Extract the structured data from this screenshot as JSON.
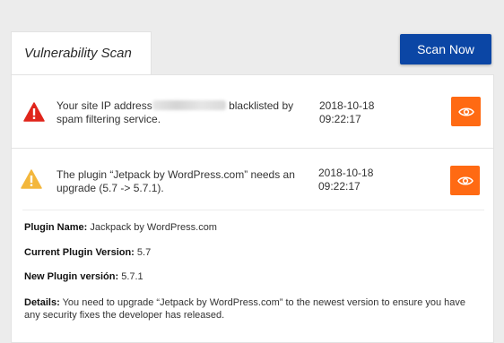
{
  "tab": {
    "title": "Vulnerability Scan"
  },
  "scan_button": {
    "label": "Scan Now"
  },
  "colors": {
    "accent_blue": "#0b46a5",
    "accent_orange": "#ff6a13",
    "error_red": "#e0251b",
    "warning_yellow": "#f3b73c"
  },
  "issues": [
    {
      "icon": "error-triangle-icon",
      "message_before": "Your site IP address",
      "message_after": "blacklisted by spam filtering service.",
      "date": "2018-10-18",
      "time": "09:22:17"
    },
    {
      "icon": "warning-triangle-icon",
      "message": "The plugin “Jetpack by WordPress.com” needs an upgrade (5.7 -> 5.7.1).",
      "date": "2018-10-18",
      "time": "09:22:17",
      "details": {
        "plugin_name_label": "Plugin Name:",
        "plugin_name_value": " Jackpack by WordPress.com",
        "current_version_label": "Current Plugin Version:",
        "current_version_value": " 5.7",
        "new_version_label": "New Plugin versión:",
        "new_version_value": " 5.7.1",
        "details_label": "Details:",
        "details_value": " You need to upgrade “Jetpack by WordPress.com” to the newest version to ensure you have any security fixes the developer has released."
      }
    }
  ]
}
